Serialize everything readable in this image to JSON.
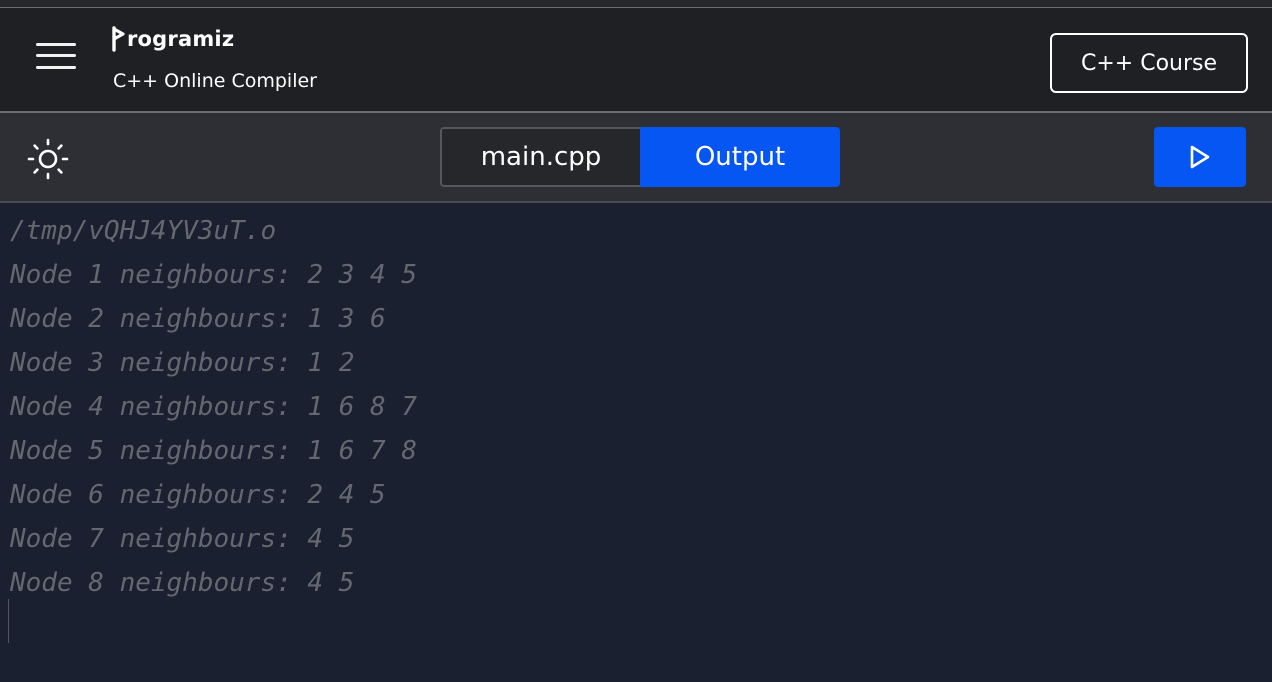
{
  "header": {
    "logo_text": "rogramiz",
    "subtitle": "C++ Online Compiler",
    "course_button": "C++ Course"
  },
  "toolbar": {
    "file_tab": "main.cpp",
    "output_tab": "Output"
  },
  "output": {
    "lines": [
      "/tmp/vQHJ4YV3uT.o",
      "Node 1 neighbours: 2 3 4 5",
      "Node 2 neighbours: 1 3 6",
      "Node 3 neighbours: 1 2",
      "Node 4 neighbours: 1 6 8 7",
      "Node 5 neighbours: 1 6 7 8",
      "Node 6 neighbours: 2 4 5",
      "Node 7 neighbours: 4 5",
      "Node 8 neighbours: 4 5"
    ]
  },
  "colors": {
    "accent": "#0556f3",
    "header_bg": "#1f2024",
    "toolbar_bg": "#2e2f34",
    "output_bg": "#1b2030",
    "output_text": "#666870"
  },
  "icons": {
    "menu": "hamburger-icon",
    "logo": "programiz-logo-icon",
    "theme": "sun-icon",
    "run": "play-icon"
  }
}
